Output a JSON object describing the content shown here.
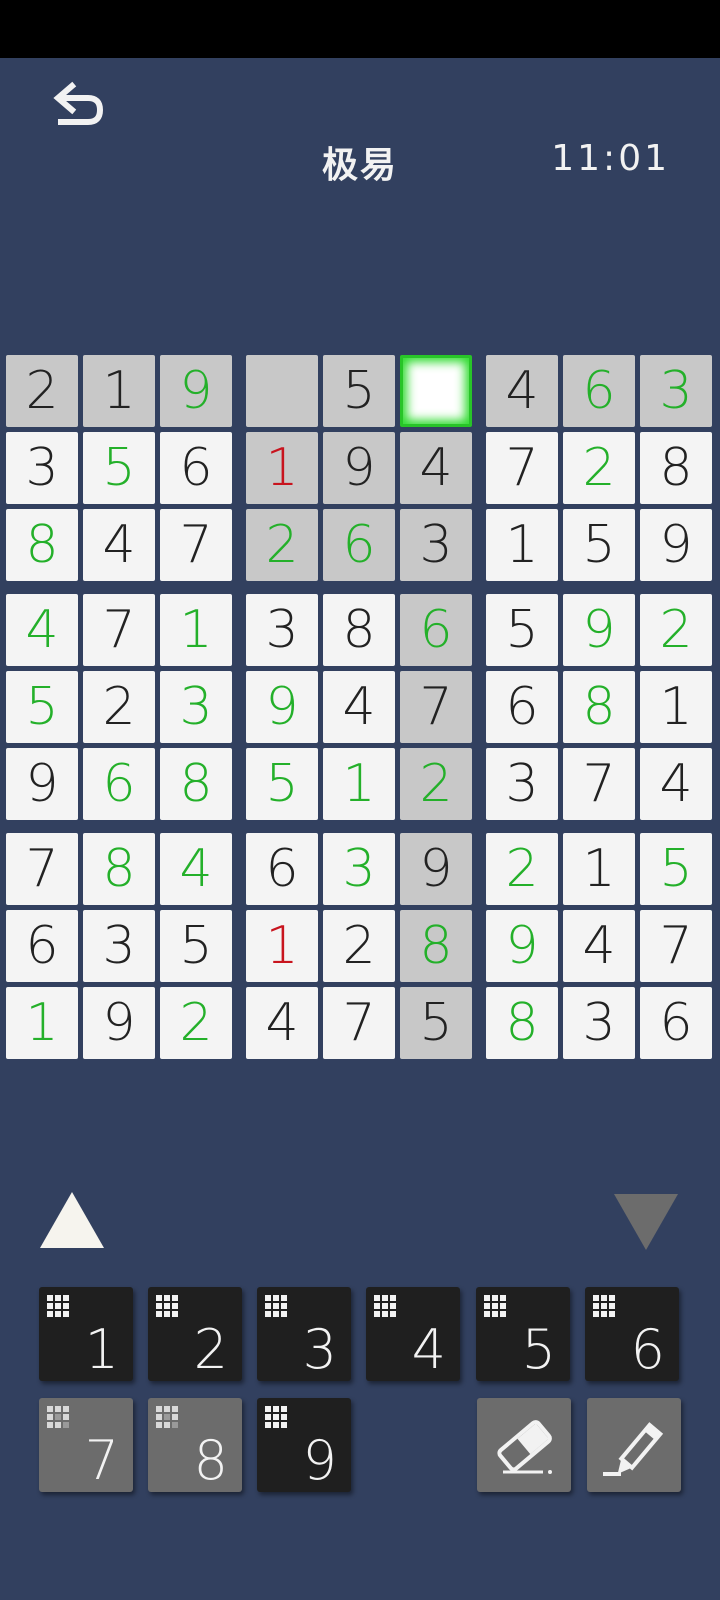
{
  "header": {
    "title": "极易",
    "timer": "11:01",
    "back_icon": "undo-arrow-icon"
  },
  "board": {
    "rows": [
      [
        "2",
        "1",
        "9",
        "",
        "5",
        "",
        "4",
        "6",
        "3"
      ],
      [
        "3",
        "5",
        "6",
        "1",
        "9",
        "4",
        "7",
        "2",
        "8"
      ],
      [
        "8",
        "4",
        "7",
        "2",
        "6",
        "3",
        "1",
        "5",
        "9"
      ],
      [
        "4",
        "7",
        "1",
        "3",
        "8",
        "6",
        "5",
        "9",
        "2"
      ],
      [
        "5",
        "2",
        "3",
        "9",
        "4",
        "7",
        "6",
        "8",
        "1"
      ],
      [
        "9",
        "6",
        "8",
        "5",
        "1",
        "2",
        "3",
        "7",
        "4"
      ],
      [
        "7",
        "8",
        "4",
        "6",
        "3",
        "9",
        "2",
        "1",
        "5"
      ],
      [
        "6",
        "3",
        "5",
        "1",
        "2",
        "8",
        "9",
        "4",
        "7"
      ],
      [
        "1",
        "9",
        "2",
        "4",
        "7",
        "5",
        "8",
        "3",
        "6"
      ]
    ],
    "colors": [
      [
        "k",
        "k",
        "g",
        "k",
        "k",
        "k",
        "k",
        "g",
        "g"
      ],
      [
        "k",
        "g",
        "k",
        "r",
        "k",
        "k",
        "k",
        "g",
        "k"
      ],
      [
        "g",
        "k",
        "k",
        "g",
        "g",
        "k",
        "k",
        "k",
        "k"
      ],
      [
        "g",
        "k",
        "g",
        "k",
        "k",
        "g",
        "k",
        "g",
        "g"
      ],
      [
        "g",
        "k",
        "g",
        "g",
        "k",
        "k",
        "k",
        "g",
        "k"
      ],
      [
        "k",
        "g",
        "g",
        "g",
        "g",
        "g",
        "k",
        "k",
        "k"
      ],
      [
        "k",
        "g",
        "g",
        "k",
        "g",
        "k",
        "g",
        "k",
        "g"
      ],
      [
        "k",
        "k",
        "k",
        "r",
        "k",
        "g",
        "g",
        "k",
        "k"
      ],
      [
        "g",
        "k",
        "g",
        "k",
        "k",
        "k",
        "g",
        "k",
        "k"
      ]
    ],
    "highlight": [
      [
        1,
        1,
        1,
        1,
        1,
        0,
        1,
        1,
        1
      ],
      [
        0,
        0,
        0,
        1,
        1,
        1,
        0,
        0,
        0
      ],
      [
        0,
        0,
        0,
        1,
        1,
        1,
        0,
        0,
        0
      ],
      [
        0,
        0,
        0,
        0,
        0,
        1,
        0,
        0,
        0
      ],
      [
        0,
        0,
        0,
        0,
        0,
        1,
        0,
        0,
        0
      ],
      [
        0,
        0,
        0,
        0,
        0,
        1,
        0,
        0,
        0
      ],
      [
        0,
        0,
        0,
        0,
        0,
        1,
        0,
        0,
        0
      ],
      [
        0,
        0,
        0,
        0,
        0,
        1,
        0,
        0,
        0
      ],
      [
        0,
        0,
        0,
        0,
        0,
        1,
        0,
        0,
        0
      ]
    ],
    "selected": {
      "row": 0,
      "col": 5
    },
    "color_map": {
      "k": "#222222",
      "g": "#24b02a",
      "r": "#c8141e"
    }
  },
  "controls": {
    "up_icon": "page-up-triangle-icon",
    "down_icon": "page-down-triangle-icon"
  },
  "keypad": {
    "keys": [
      {
        "label": "1",
        "style": "dark"
      },
      {
        "label": "2",
        "style": "dark"
      },
      {
        "label": "3",
        "style": "dark"
      },
      {
        "label": "4",
        "style": "dark"
      },
      {
        "label": "5",
        "style": "dark"
      },
      {
        "label": "6",
        "style": "dark"
      },
      {
        "label": "7",
        "style": "gray"
      },
      {
        "label": "8",
        "style": "gray"
      },
      {
        "label": "9",
        "style": "dark"
      }
    ],
    "eraser_icon": "eraser-icon",
    "pencil_icon": "pencil-icon"
  }
}
